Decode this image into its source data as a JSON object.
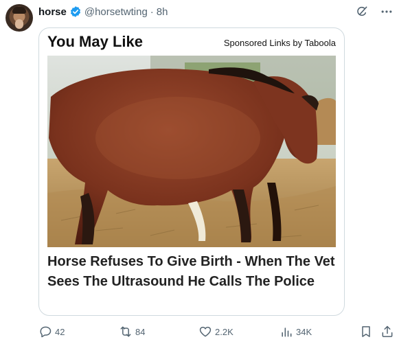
{
  "tweet": {
    "author_name": "horse",
    "handle": "@horsetwting",
    "separator": "·",
    "time": "8h"
  },
  "ad": {
    "title": "You May Like",
    "sponsor": "Sponsored Links by Taboola",
    "headline": "Horse Refuses To Give Birth - When The Vet Sees The Ultrasound He Calls The Police"
  },
  "actions": {
    "replies": "42",
    "reposts": "84",
    "likes": "2.2K",
    "views": "34K"
  },
  "colors": {
    "verified": "#1d9bf0",
    "muted": "#536471",
    "border": "#cfd9de"
  },
  "icons": [
    "verified-badge-icon",
    "grok-icon",
    "more-icon",
    "reply-icon",
    "repost-icon",
    "like-icon",
    "views-icon",
    "bookmark-icon",
    "share-icon"
  ]
}
